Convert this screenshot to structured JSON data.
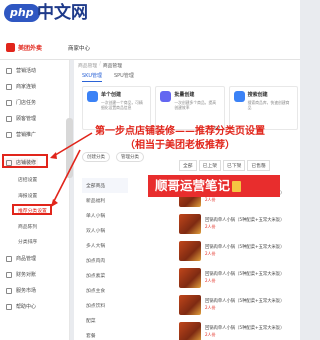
{
  "watermark": {
    "logo": "php",
    "text": "中文网"
  },
  "app": {
    "brand": "美团外卖",
    "merchant": "商家中心"
  },
  "breadcrumb": [
    "商品管理",
    "商品管理"
  ],
  "tabs": [
    {
      "label": "SKU管理",
      "active": true
    },
    {
      "label": "SPU管理",
      "active": false
    }
  ],
  "cards": [
    {
      "title": "单个创建",
      "desc": "一次创建一个商品，可精细化设置商品信息",
      "color": "#3b82f6"
    },
    {
      "title": "批量创建",
      "desc": "一次创建多个商品，提高创建效率",
      "color": "#6366f1"
    },
    {
      "title": "搜索创建",
      "desc": "搜索商品库，快速创建商品",
      "color": "#3b82f6"
    }
  ],
  "sidebar": [
    {
      "label": "营销活动"
    },
    {
      "label": "商家连锁"
    },
    {
      "label": "门店任务"
    },
    {
      "label": "顾客管理"
    },
    {
      "label": "营销推广"
    },
    {
      "label": "店铺装修"
    },
    {
      "label": "商品管理"
    },
    {
      "label": "财务对账"
    },
    {
      "label": "服务市场"
    },
    {
      "label": "帮助中心"
    }
  ],
  "sidebar_sub": [
    "店招设置",
    "海报设置",
    "推荐分类设置",
    "商品陈列",
    "分类排序"
  ],
  "toolbar": {
    "left": "创建分类",
    "right": "管理分类"
  },
  "filters": [
    "全部",
    "已上架",
    "已下架",
    "已售罄"
  ],
  "spu_label": "SP",
  "categories": [
    "全部商品",
    "新品福利",
    "单人小锅",
    "双人小锅",
    "多人大锅",
    "加点肉肉",
    "加点素菜",
    "加点主食",
    "加点饮料",
    "配菜",
    "套餐"
  ],
  "products": [
    {
      "name": "回锅肉单人小锅（5种配菜+五常大米饭）",
      "meta": "2人份"
    },
    {
      "name": "回锅肉单人小锅（5种配菜+五常大米饭）",
      "meta": "2人份"
    },
    {
      "name": "回锅肉单人小锅（5种配菜+五常大米饭）",
      "meta": "2人份"
    },
    {
      "name": "回锅肉单人小锅（5种配菜+五常大米饭）",
      "meta": "2人份"
    },
    {
      "name": "回锅肉单人小锅（5种配菜+五常大米饭）",
      "meta": "2人份"
    },
    {
      "name": "回锅肉单人小锅（5种配菜+五常大米饭）",
      "meta": "2人份"
    }
  ],
  "overlay": {
    "step_line1": "第一步点店铺装修——推荐分类页设置",
    "step_line2": "（相当于美团老板推荐）",
    "badge": "顺哥运营笔记"
  }
}
